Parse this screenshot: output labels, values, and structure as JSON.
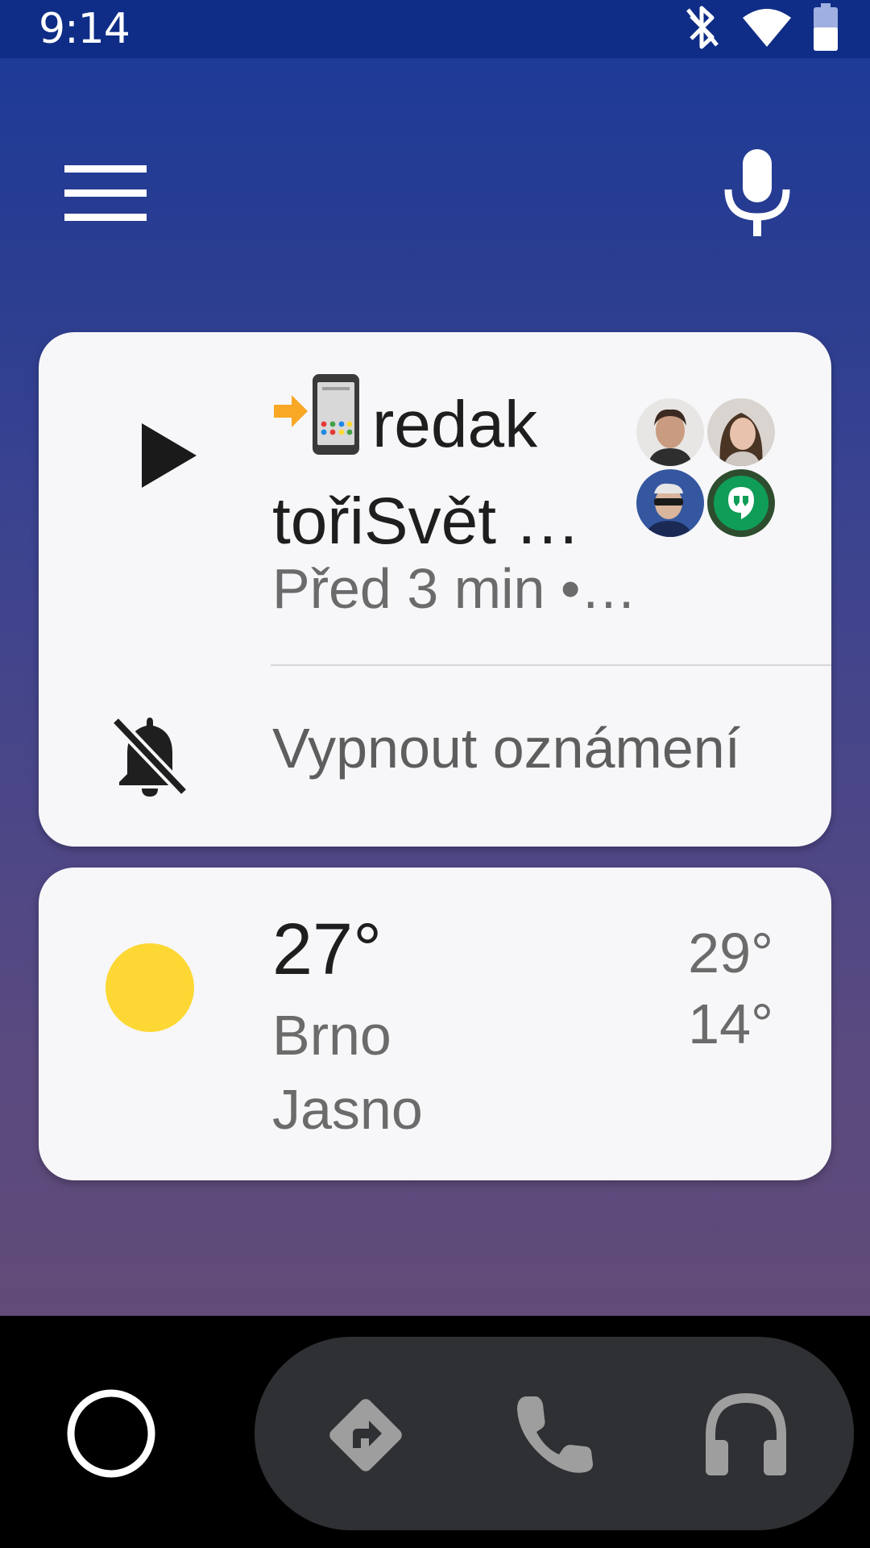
{
  "status_bar": {
    "time": "9:14",
    "icons": [
      "bluetooth-icon",
      "wifi-icon",
      "battery-icon"
    ]
  },
  "top_bar": {
    "menu_icon": "menu-icon",
    "mic_icon": "mic-icon"
  },
  "message_card": {
    "title_line1": "redak",
    "title_line2": "tořiSvět …",
    "subtitle": "Před 3 min •…",
    "mute_label": "Vypnout oznámení",
    "avatars": [
      "avatar-1",
      "avatar-2",
      "avatar-3",
      "hangouts-icon"
    ],
    "accent": "#0f9d58"
  },
  "weather_card": {
    "temperature": "27°",
    "city": "Brno",
    "condition": "Jasno",
    "high": "29°",
    "low": "14°",
    "sun_color": "#fdd835"
  },
  "nav_bar": {
    "items": [
      "home-icon",
      "navigation-icon",
      "phone-icon",
      "headphones-icon"
    ]
  }
}
